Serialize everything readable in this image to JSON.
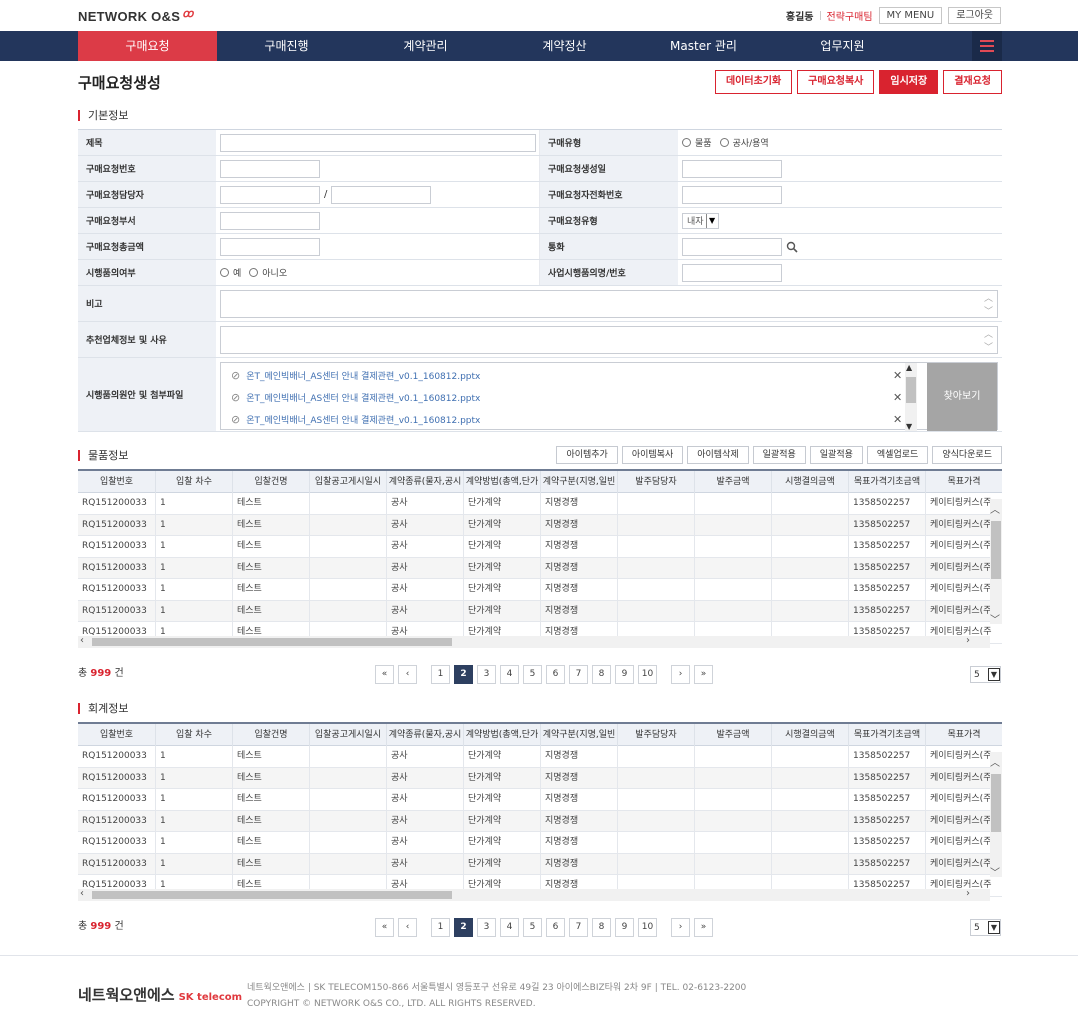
{
  "header": {
    "logo": "NETWORK O&S",
    "user_name": "홍길동",
    "department": "전략구매팀",
    "my_menu": "MY MENU",
    "logout": "로그아웃"
  },
  "nav": {
    "items": [
      "구매요청",
      "구매진행",
      "계약관리",
      "계약정산",
      "Master 관리",
      "업무지원"
    ]
  },
  "page": {
    "title": "구매요청생성",
    "actions": [
      "데이터초기화",
      "구매요청복사",
      "임시저장",
      "결재요청"
    ]
  },
  "basic_info": {
    "section_title": "기본정보",
    "labels": {
      "title": "제목",
      "purchase_type": "구매유형",
      "request_no": "구매요청번호",
      "created_date": "구매요청생성일",
      "requester": "구매요청담당자",
      "requester_phone": "구매요청자전화번호",
      "department": "구매요청부서",
      "request_type": "구매요청유형",
      "total_amount": "구매요청총금액",
      "currency": "통화",
      "sample_intent": "시행품의여부",
      "project_name": "사업시행품의명/번호",
      "remarks": "비고",
      "recommend": "추천업체정보 및 사유",
      "attachments": "시행품의원안 및 첨부파일"
    },
    "purchase_type_options": [
      "물품",
      "공사/용역"
    ],
    "sample_options": [
      "예",
      "아니오"
    ],
    "requester_sep": "/",
    "request_type_value": "내자",
    "files": [
      "온T_메인빅배너_AS센터 안내 결제관련_v0.1_160812.pptx",
      "온T_메인빅배너_AS센터 안내 결제관련_v0.1_160812.pptx",
      "온T_메인빅배너_AS센터 안내 결제관련_v0.1_160812.pptx"
    ],
    "find_button": "찾아보기"
  },
  "items": {
    "section_title": "물품정보",
    "tools": [
      "아이템추가",
      "아이템복사",
      "아이템삭제",
      "일괄적용",
      "일괄적용",
      "엑셀업로드",
      "양식다운로드"
    ],
    "columns": [
      "입찰번호",
      "입찰 차수",
      "입찰건명",
      "입찰공고게시일시",
      "계약종류(물자,공시",
      "계약방법(총액,단가",
      "계약구분(지명,일빈",
      "발주담당자",
      "발주금액",
      "시행결의금액",
      "목표가격기초금액",
      "목표가격"
    ],
    "rows": [
      [
        "RQ151200033",
        "1",
        "테스트",
        "",
        "공사",
        "단가계약",
        "지명경쟁",
        "",
        "",
        "",
        "1358502257",
        "케이티링커스(주"
      ],
      [
        "RQ151200033",
        "1",
        "테스트",
        "",
        "공사",
        "단가계약",
        "지명경쟁",
        "",
        "",
        "",
        "1358502257",
        "케이티링커스(주"
      ],
      [
        "RQ151200033",
        "1",
        "테스트",
        "",
        "공사",
        "단가계약",
        "지명경쟁",
        "",
        "",
        "",
        "1358502257",
        "케이티링커스(주"
      ],
      [
        "RQ151200033",
        "1",
        "테스트",
        "",
        "공사",
        "단가계약",
        "지명경쟁",
        "",
        "",
        "",
        "1358502257",
        "케이티링커스(주"
      ],
      [
        "RQ151200033",
        "1",
        "테스트",
        "",
        "공사",
        "단가계약",
        "지명경쟁",
        "",
        "",
        "",
        "1358502257",
        "케이티링커스(주"
      ],
      [
        "RQ151200033",
        "1",
        "테스트",
        "",
        "공사",
        "단가계약",
        "지명경쟁",
        "",
        "",
        "",
        "1358502257",
        "케이티링커스(주"
      ],
      [
        "RQ151200033",
        "1",
        "테스트",
        "",
        "공사",
        "단가계약",
        "지명경쟁",
        "",
        "",
        "",
        "1358502257",
        "케이티링커스(주"
      ]
    ],
    "total_prefix": "총",
    "total_count": "999",
    "total_suffix": "건",
    "pages": [
      "1",
      "2",
      "3",
      "4",
      "5",
      "6",
      "7",
      "8",
      "9",
      "10"
    ],
    "first": "«",
    "prev": "‹",
    "next": "›",
    "last": "»",
    "page_size": "5"
  },
  "accounting": {
    "section_title": "회계정보",
    "columns": [
      "입찰번호",
      "입찰 차수",
      "입찰건명",
      "입찰공고게시일시",
      "계약종류(물자,공시",
      "계약방법(총액,단가",
      "계약구분(지명,일빈",
      "발주담당자",
      "발주금액",
      "시행결의금액",
      "목표가격기초금액",
      "목표가격"
    ],
    "rows": [
      [
        "RQ151200033",
        "1",
        "테스트",
        "",
        "공사",
        "단가계약",
        "지명경쟁",
        "",
        "",
        "",
        "1358502257",
        "케이티링커스(주"
      ],
      [
        "RQ151200033",
        "1",
        "테스트",
        "",
        "공사",
        "단가계약",
        "지명경쟁",
        "",
        "",
        "",
        "1358502257",
        "케이티링커스(주"
      ],
      [
        "RQ151200033",
        "1",
        "테스트",
        "",
        "공사",
        "단가계약",
        "지명경쟁",
        "",
        "",
        "",
        "1358502257",
        "케이티링커스(주"
      ],
      [
        "RQ151200033",
        "1",
        "테스트",
        "",
        "공사",
        "단가계약",
        "지명경쟁",
        "",
        "",
        "",
        "1358502257",
        "케이티링커스(주"
      ],
      [
        "RQ151200033",
        "1",
        "테스트",
        "",
        "공사",
        "단가계약",
        "지명경쟁",
        "",
        "",
        "",
        "1358502257",
        "케이티링커스(주"
      ],
      [
        "RQ151200033",
        "1",
        "테스트",
        "",
        "공사",
        "단가계약",
        "지명경쟁",
        "",
        "",
        "",
        "1358502257",
        "케이티링커스(주"
      ],
      [
        "RQ151200033",
        "1",
        "테스트",
        "",
        "공사",
        "단가계약",
        "지명경쟁",
        "",
        "",
        "",
        "1358502257",
        "케이티링커스(주"
      ]
    ],
    "total_prefix": "총",
    "total_count": "999",
    "total_suffix": "건",
    "pages": [
      "1",
      "2",
      "3",
      "4",
      "5",
      "6",
      "7",
      "8",
      "9",
      "10"
    ],
    "first": "«",
    "prev": "‹",
    "next": "›",
    "last": "»",
    "page_size": "5"
  },
  "footer": {
    "brand": "네트웍오앤에스",
    "partner": "SK telecom",
    "address": "네트웍오앤에스 | SK TELECOM150-866 서울특별시 영등포구 선유로 49길 23 아이에스BIZ타워 2차 9F | TEL. 02-6123-2200",
    "copyright": "COPYRIGHT © NETWORK O&S CO., LTD. ALL RIGHTS RESERVED."
  },
  "colors": {
    "accent": "#d9232f",
    "nav_bg": "#23365c",
    "nav_active": "#dc3b47"
  }
}
